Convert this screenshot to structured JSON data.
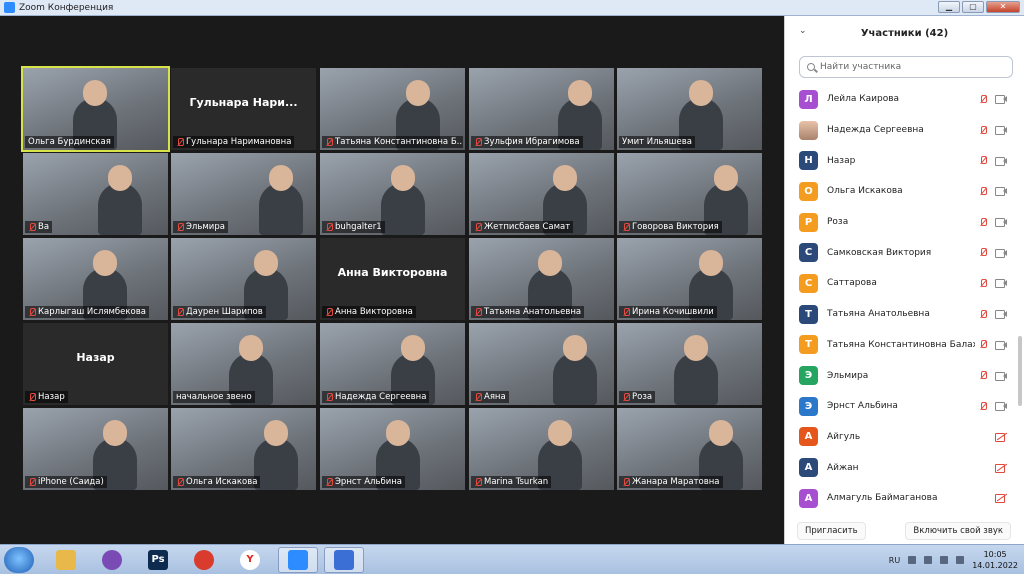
{
  "window": {
    "title": "Zoom Конференция"
  },
  "gallery": {
    "tiles": [
      {
        "label": "Ольга Бурдинская",
        "muted": false,
        "video": true,
        "active": true,
        "center_name": ""
      },
      {
        "label": "Гульнара Наримановна",
        "muted": true,
        "video": false,
        "active": false,
        "center_name": "Гульнара Нари..."
      },
      {
        "label": "Татьяна Константиновна Б...",
        "muted": true,
        "video": true,
        "active": false,
        "center_name": ""
      },
      {
        "label": "Зульфия Ибрагимова",
        "muted": true,
        "video": true,
        "active": false,
        "center_name": ""
      },
      {
        "label": "Умит Ильяшева",
        "muted": false,
        "video": true,
        "active": false,
        "center_name": ""
      },
      {
        "label": "Ва",
        "muted": true,
        "video": true,
        "active": false,
        "center_name": ""
      },
      {
        "label": "Эльмира",
        "muted": true,
        "video": true,
        "active": false,
        "center_name": ""
      },
      {
        "label": "buhgalter1",
        "muted": true,
        "video": true,
        "active": false,
        "center_name": ""
      },
      {
        "label": "Жетписбаев Самат",
        "muted": true,
        "video": true,
        "active": false,
        "center_name": ""
      },
      {
        "label": "Говорова Виктория",
        "muted": true,
        "video": true,
        "active": false,
        "center_name": ""
      },
      {
        "label": "Карлыгаш Ислямбекова",
        "muted": true,
        "video": true,
        "active": false,
        "center_name": ""
      },
      {
        "label": "Даурен Шарипов",
        "muted": true,
        "video": true,
        "active": false,
        "center_name": ""
      },
      {
        "label": "Анна Викторовна",
        "muted": true,
        "video": false,
        "active": false,
        "center_name": "Анна Викторовна"
      },
      {
        "label": "Татьяна Анатольевна",
        "muted": true,
        "video": true,
        "active": false,
        "center_name": ""
      },
      {
        "label": "Ирина Кочишвили",
        "muted": true,
        "video": true,
        "active": false,
        "center_name": ""
      },
      {
        "label": "Назар",
        "muted": true,
        "video": false,
        "active": false,
        "center_name": "Назар"
      },
      {
        "label": "начальное звено",
        "muted": false,
        "video": true,
        "active": false,
        "center_name": ""
      },
      {
        "label": "Надежда Сергеевна",
        "muted": true,
        "video": true,
        "active": false,
        "center_name": ""
      },
      {
        "label": "Аяна",
        "muted": true,
        "video": true,
        "active": false,
        "center_name": ""
      },
      {
        "label": "Роза",
        "muted": true,
        "video": true,
        "active": false,
        "center_name": ""
      },
      {
        "label": "iPhone (Саида)",
        "muted": true,
        "video": true,
        "active": false,
        "center_name": ""
      },
      {
        "label": "Ольга Искакова",
        "muted": true,
        "video": true,
        "active": false,
        "center_name": ""
      },
      {
        "label": "Эрнст Альбина",
        "muted": true,
        "video": true,
        "active": false,
        "center_name": ""
      },
      {
        "label": "Marina Tsurkan",
        "muted": true,
        "video": true,
        "active": false,
        "center_name": ""
      },
      {
        "label": "Жанара Маратовна",
        "muted": true,
        "video": true,
        "active": false,
        "center_name": ""
      }
    ]
  },
  "participants": {
    "title": "Участники (42)",
    "search_placeholder": "Найти участника",
    "items": [
      {
        "initial": "Л",
        "name": "Лейла Каирова",
        "color": "#a64fd1",
        "photo": false,
        "video_off": true
      },
      {
        "initial": "",
        "name": "Надежда Сергеевна",
        "color": "#c49a80",
        "photo": true,
        "video_off": true
      },
      {
        "initial": "Н",
        "name": "Назар",
        "color": "#2b4a7a",
        "photo": false,
        "video_off": true
      },
      {
        "initial": "О",
        "name": "Ольга Искакова",
        "color": "#f39c1f",
        "photo": false,
        "video_off": true
      },
      {
        "initial": "Р",
        "name": "Роза",
        "color": "#f39c1f",
        "photo": false,
        "video_off": true
      },
      {
        "initial": "С",
        "name": "Самковская Виктория",
        "color": "#2b4a7a",
        "photo": false,
        "video_off": true
      },
      {
        "initial": "С",
        "name": "Саттарова",
        "color": "#f39c1f",
        "photo": false,
        "video_off": true
      },
      {
        "initial": "Т",
        "name": "Татьяна Анатольевна",
        "color": "#2b4a7a",
        "photo": false,
        "video_off": true
      },
      {
        "initial": "Т",
        "name": "Татьяна Константиновна Балах...",
        "color": "#f39c1f",
        "photo": false,
        "video_off": true
      },
      {
        "initial": "Э",
        "name": "Эльмира",
        "color": "#25a55f",
        "photo": false,
        "video_off": true
      },
      {
        "initial": "Э",
        "name": "Эрнст Альбина",
        "color": "#2b77c9",
        "photo": false,
        "video_off": true
      },
      {
        "initial": "А",
        "name": "Айгуль",
        "color": "#e5561c",
        "photo": false,
        "video_off": false
      },
      {
        "initial": "А",
        "name": "Айжан",
        "color": "#2b4a7a",
        "photo": false,
        "video_off": false
      },
      {
        "initial": "А",
        "name": "Алмагуль Баймаганова",
        "color": "#a64fd1",
        "photo": false,
        "video_off": false
      }
    ],
    "invite_label": "Пригласить",
    "unmute_label": "Включить свой звук"
  },
  "taskbar": {
    "apps": [
      {
        "icon": "windows-start-icon"
      },
      {
        "icon": "folder-icon",
        "color": "#e8b84a"
      },
      {
        "icon": "tor-browser-icon",
        "color": "#7a4bb5"
      },
      {
        "icon": "photoshop-icon",
        "color": "#0d2a4f",
        "text": "Ps"
      },
      {
        "icon": "chrome-icon",
        "color": "#d93b2c"
      },
      {
        "icon": "yandex-browser-icon",
        "color": "#ffffff",
        "text": "Y"
      },
      {
        "icon": "zoom-icon",
        "color": "#2d8cff"
      },
      {
        "icon": "cloud-app-icon",
        "color": "#3b6fd6"
      }
    ],
    "lang": "RU",
    "time": "10:05",
    "date": "14.01.2022"
  }
}
